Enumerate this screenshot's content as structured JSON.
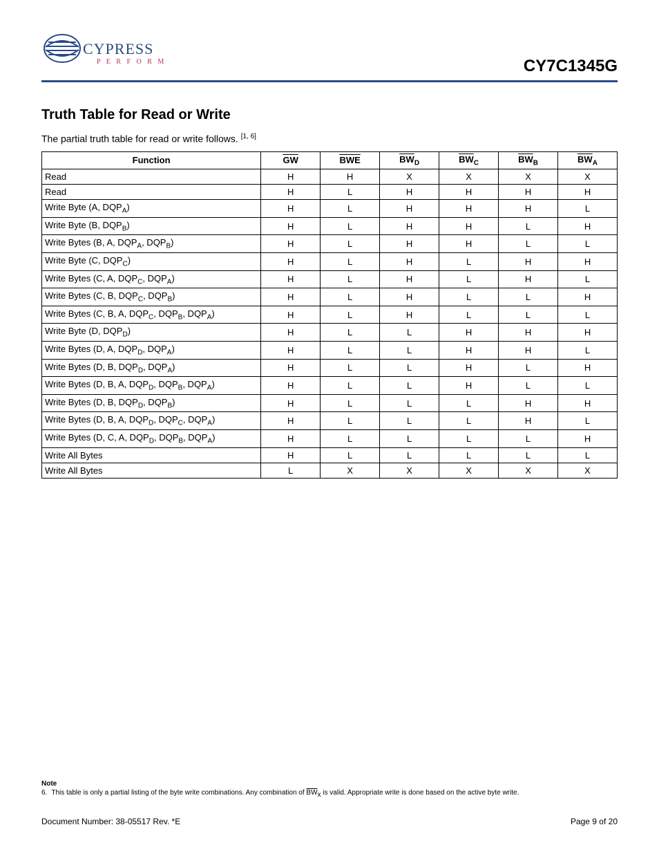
{
  "header": {
    "part_number": "CY7C1345G",
    "logo_name": "CYPRESS",
    "logo_tag": "P E R F O R M"
  },
  "section": {
    "title": "Truth Table for Read or Write",
    "intro_a": "The partial truth table for read or write follows. ",
    "intro_ref": "[1, 6]"
  },
  "table": {
    "headers": {
      "function": "Function",
      "gw": "GW",
      "bwe": "BWE",
      "bwd_pre": "BW",
      "bwd_sub": "D",
      "bwc_pre": "BW",
      "bwc_sub": "C",
      "bwb_pre": "BW",
      "bwb_sub": "B",
      "bwa_pre": "BW",
      "bwa_sub": "A"
    },
    "rows": [
      {
        "func_parts": [
          {
            "t": "Read"
          }
        ],
        "v": [
          "H",
          "H",
          "X",
          "X",
          "X",
          "X"
        ]
      },
      {
        "func_parts": [
          {
            "t": "Read"
          }
        ],
        "v": [
          "H",
          "L",
          "H",
          "H",
          "H",
          "H"
        ]
      },
      {
        "func_parts": [
          {
            "t": "Write Byte (A, DQP"
          },
          {
            "s": "A"
          },
          {
            "t": ")"
          }
        ],
        "v": [
          "H",
          "L",
          "H",
          "H",
          "H",
          "L"
        ]
      },
      {
        "func_parts": [
          {
            "t": "Write Byte (B, DQP"
          },
          {
            "s": "B"
          },
          {
            "t": ")"
          }
        ],
        "v": [
          "H",
          "L",
          "H",
          "H",
          "L",
          "H"
        ]
      },
      {
        "func_parts": [
          {
            "t": "Write Bytes (B, A, DQP"
          },
          {
            "s": "A"
          },
          {
            "t": ", DQP"
          },
          {
            "s": "B"
          },
          {
            "t": ")"
          }
        ],
        "v": [
          "H",
          "L",
          "H",
          "H",
          "L",
          "L"
        ]
      },
      {
        "func_parts": [
          {
            "t": "Write Byte (C, DQP"
          },
          {
            "s": "C"
          },
          {
            "t": ")"
          }
        ],
        "v": [
          "H",
          "L",
          "H",
          "L",
          "H",
          "H"
        ]
      },
      {
        "func_parts": [
          {
            "t": "Write Bytes (C, A, DQP"
          },
          {
            "s": "C"
          },
          {
            "t": ", DQP"
          },
          {
            "s": "A"
          },
          {
            "t": ")"
          }
        ],
        "v": [
          "H",
          "L",
          "H",
          "L",
          "H",
          "L"
        ]
      },
      {
        "func_parts": [
          {
            "t": "Write Bytes (C, B, DQP"
          },
          {
            "s": "C"
          },
          {
            "t": ", DQP"
          },
          {
            "s": "B"
          },
          {
            "t": ")"
          }
        ],
        "v": [
          "H",
          "L",
          "H",
          "L",
          "L",
          "H"
        ]
      },
      {
        "func_parts": [
          {
            "t": "Write Bytes (C, B, A, DQP"
          },
          {
            "s": "C"
          },
          {
            "t": ", DQP"
          },
          {
            "s": "B"
          },
          {
            "t": ", DQP"
          },
          {
            "s": "A"
          },
          {
            "t": ")"
          }
        ],
        "v": [
          "H",
          "L",
          "H",
          "L",
          "L",
          "L"
        ]
      },
      {
        "func_parts": [
          {
            "t": "Write Byte (D, DQP"
          },
          {
            "s": "D"
          },
          {
            "t": ")"
          }
        ],
        "v": [
          "H",
          "L",
          "L",
          "H",
          "H",
          "H"
        ]
      },
      {
        "func_parts": [
          {
            "t": "Write Bytes (D, A, DQP"
          },
          {
            "s": "D"
          },
          {
            "t": ", DQP"
          },
          {
            "s": "A"
          },
          {
            "t": ")"
          }
        ],
        "v": [
          "H",
          "L",
          "L",
          "H",
          "H",
          "L"
        ]
      },
      {
        "func_parts": [
          {
            "t": "Write Bytes (D, B, DQP"
          },
          {
            "s": "D"
          },
          {
            "t": ", DQP"
          },
          {
            "s": "A"
          },
          {
            "t": ")"
          }
        ],
        "v": [
          "H",
          "L",
          "L",
          "H",
          "L",
          "H"
        ]
      },
      {
        "func_parts": [
          {
            "t": "Write Bytes (D, B, A, DQP"
          },
          {
            "s": "D"
          },
          {
            "t": ", DQP"
          },
          {
            "s": "B"
          },
          {
            "t": ", DQP"
          },
          {
            "s": "A"
          },
          {
            "t": ")"
          }
        ],
        "v": [
          "H",
          "L",
          "L",
          "H",
          "L",
          "L"
        ]
      },
      {
        "func_parts": [
          {
            "t": "Write Bytes (D, B, DQP"
          },
          {
            "s": "D"
          },
          {
            "t": ", DQP"
          },
          {
            "s": "B"
          },
          {
            "t": ")"
          }
        ],
        "v": [
          "H",
          "L",
          "L",
          "L",
          "H",
          "H"
        ]
      },
      {
        "func_parts": [
          {
            "t": "Write Bytes (D, B, A, DQP"
          },
          {
            "s": "D"
          },
          {
            "t": ", DQP"
          },
          {
            "s": "C"
          },
          {
            "t": ", DQP"
          },
          {
            "s": "A"
          },
          {
            "t": ")"
          }
        ],
        "v": [
          "H",
          "L",
          "L",
          "L",
          "H",
          "L"
        ]
      },
      {
        "func_parts": [
          {
            "t": "Write Bytes (D, C, A, DQP"
          },
          {
            "s": "D"
          },
          {
            "t": ", DQP"
          },
          {
            "s": "B"
          },
          {
            "t": ", DQP"
          },
          {
            "s": "A"
          },
          {
            "t": ")"
          }
        ],
        "v": [
          "H",
          "L",
          "L",
          "L",
          "L",
          "H"
        ]
      },
      {
        "func_parts": [
          {
            "t": "Write All Bytes"
          }
        ],
        "v": [
          "H",
          "L",
          "L",
          "L",
          "L",
          "L"
        ]
      },
      {
        "func_parts": [
          {
            "t": "Write All Bytes"
          }
        ],
        "v": [
          "L",
          "X",
          "X",
          "X",
          "X",
          "X"
        ]
      }
    ]
  },
  "note": {
    "title": "Note",
    "num": "6.",
    "text_a": "This table is only a partial listing of the byte write combinations. Any combination of ",
    "text_bw": "BW",
    "text_bw_sub": "x",
    "text_b": " is valid. Appropriate write is done based on the active byte write."
  },
  "footer": {
    "left": "Document Number: 38-05517 Rev. *E",
    "right": "Page 9 of 20"
  }
}
